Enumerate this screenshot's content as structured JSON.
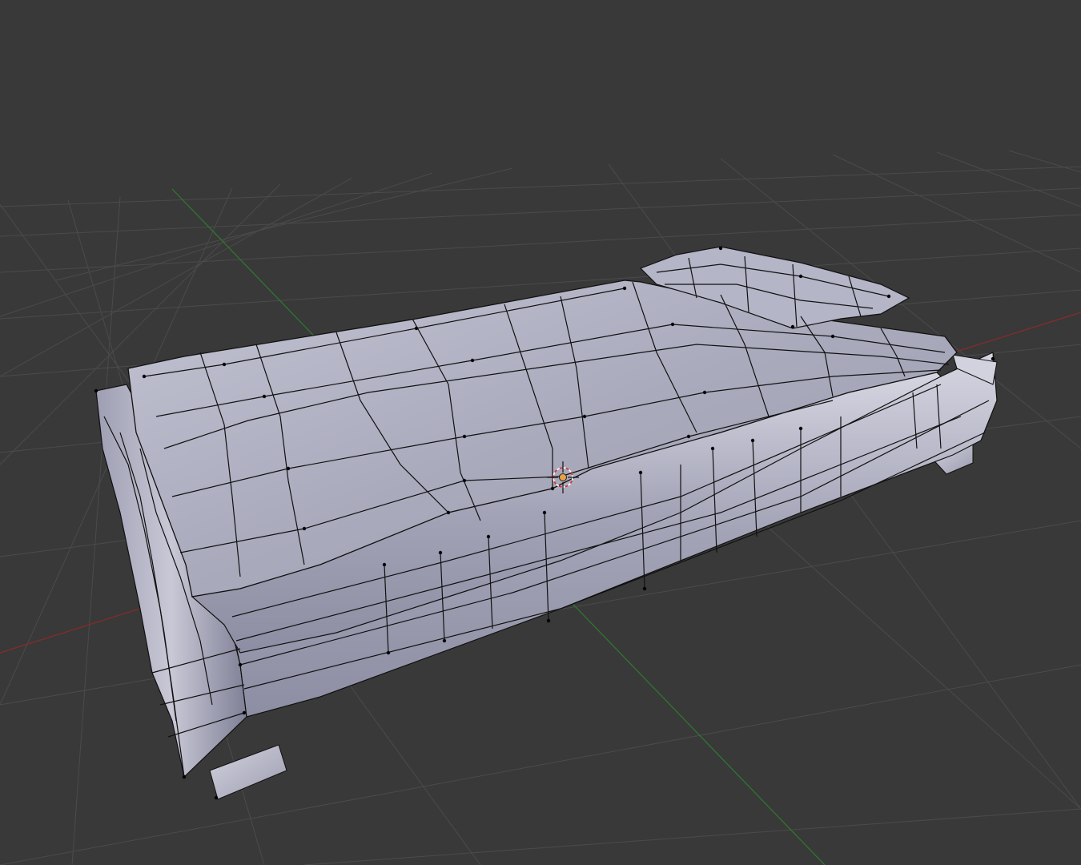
{
  "viewport": {
    "background": "#393939",
    "grid_color": "#4b4b4b",
    "x_axis_color": "#8a2a2a",
    "y_axis_color": "#2f7a2f",
    "shading_dark": "#6f6f86",
    "shading_light": "#d9d9e6",
    "wire_color": "#111111"
  },
  "scene": {
    "object": "bed-mesh",
    "mode": "edit-mode-wireframe"
  },
  "cursor_3d": {
    "icon": "3d-cursor-icon"
  }
}
